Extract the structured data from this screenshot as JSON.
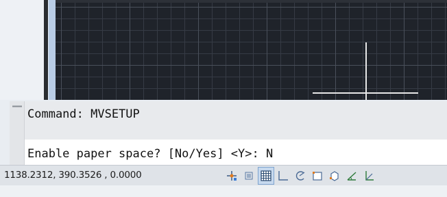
{
  "command_window": {
    "history": "Command: MVSETUP",
    "prompt": "Enable paper space? [No/Yes] <Y>: ",
    "input_value": "N"
  },
  "status_bar": {
    "coordinates": "1138.2312, 390.3526 , 0.0000",
    "buttons": [
      {
        "name": "snap-icon",
        "state": "off"
      },
      {
        "name": "infer-constraints-icon",
        "state": "off"
      },
      {
        "name": "grid-icon",
        "state": "on"
      },
      {
        "name": "ortho-icon",
        "state": "off"
      },
      {
        "name": "polar-icon",
        "state": "off"
      },
      {
        "name": "object-snap-icon",
        "state": "off"
      },
      {
        "name": "3d-object-snap-icon",
        "state": "off"
      },
      {
        "name": "object-snap-tracking-icon",
        "state": "off"
      },
      {
        "name": "dynamic-ucs-icon",
        "state": "off"
      }
    ]
  },
  "colors": {
    "canvas_bg": "#1f232a",
    "crosshair": "#e9e9e9",
    "grid_toggle_on": "#c7d9ee",
    "accent_orange": "#e07a1f"
  }
}
